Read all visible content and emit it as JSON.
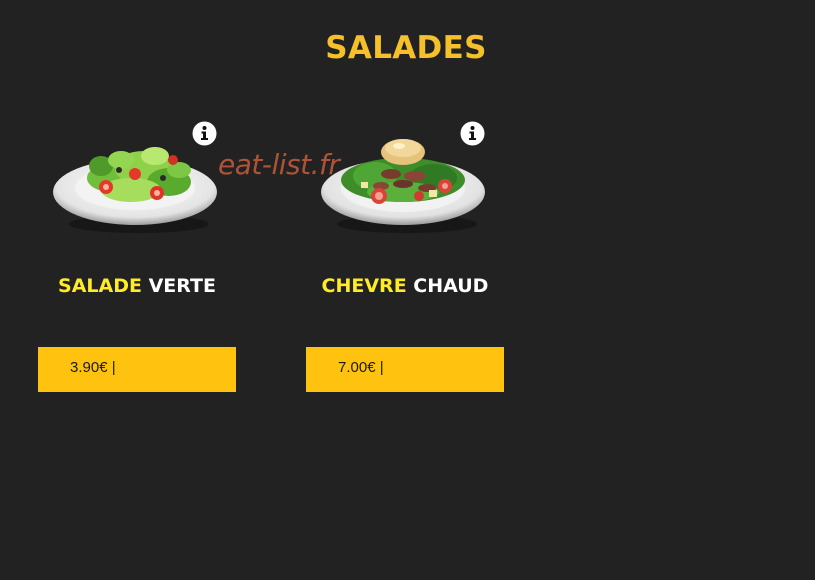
{
  "section": {
    "title": "SALADES"
  },
  "watermark": "eat-list.fr",
  "products": [
    {
      "name_highlight": "SALADE",
      "name_rest": " VERTE",
      "price": "3.90€ |",
      "image_icon": "green-salad-plate",
      "info_icon": "info-icon"
    },
    {
      "name_highlight": "CHEVRE",
      "name_rest": " CHAUD",
      "price": "7.00€ |",
      "image_icon": "goat-cheese-salad-plate",
      "info_icon": "info-icon"
    }
  ],
  "colors": {
    "background": "#222222",
    "title": "#f6c02a",
    "name_highlight": "#ffec27",
    "price_box": "#ffc20e",
    "watermark": "#c85c3a"
  }
}
